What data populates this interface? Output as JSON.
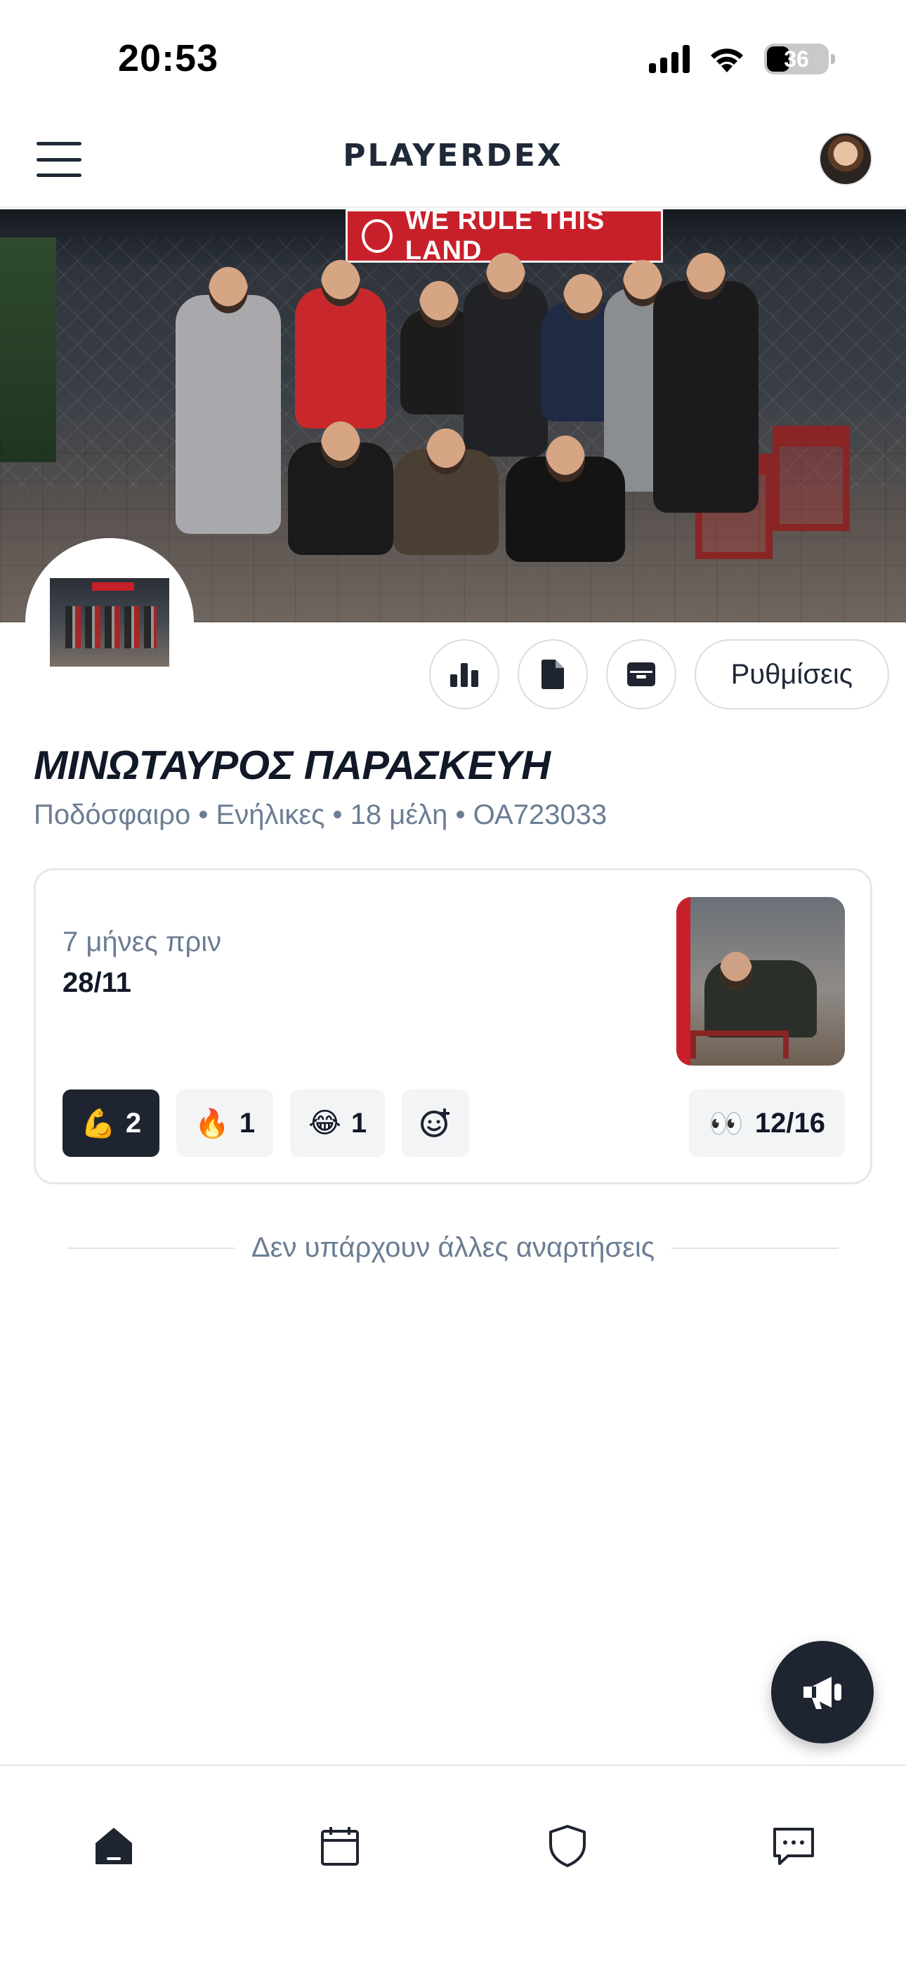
{
  "status_bar": {
    "time": "20:53",
    "battery": "36",
    "icons": [
      "signal-icon",
      "wifi-icon",
      "battery-icon"
    ]
  },
  "header": {
    "brand": "PLAYERDEX",
    "menu_icon": "hamburger-menu-icon",
    "avatar": "user-avatar"
  },
  "cover": {
    "banner_text": "WE RULE THIS LAND"
  },
  "actions": {
    "stats_icon": "bar-chart-icon",
    "document_icon": "document-icon",
    "archive_icon": "archive-icon",
    "settings_label": "Ρυθμίσεις"
  },
  "team": {
    "name": "ΜΙΝΩΤΑΥΡΟΣ ΠΑΡΑΣΚΕΥΗ",
    "meta": "Ποδόσφαιρο • Ενήλικες • 18 μέλη • ΟΑ723033"
  },
  "post": {
    "time_ago": "7 μήνες πριν",
    "date": "28/11",
    "reactions": [
      {
        "emoji": "💪",
        "count": "2",
        "active": true
      },
      {
        "emoji": "🔥",
        "count": "1",
        "active": false
      },
      {
        "emoji": "😂",
        "count": "1",
        "active": false
      }
    ],
    "add_reaction_icon": "add-emoji-icon",
    "views_emoji": "👀",
    "views": "12/16"
  },
  "feed_end": "Δεν υπάρχουν άλλες αναρτήσεις",
  "fab_icon": "megaphone-icon",
  "bottom_nav": [
    "home-icon",
    "calendar-icon",
    "shield-icon",
    "chat-icon"
  ],
  "colors": {
    "dark": "#1f2530",
    "muted": "#6b7d93",
    "border": "#e5e7eb",
    "banner_red": "#c8202a"
  }
}
